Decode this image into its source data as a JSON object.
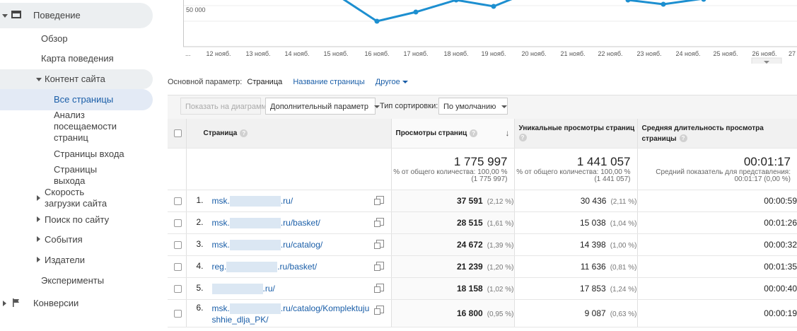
{
  "sidebar": {
    "behavior": "Поведение",
    "overview": "Обзор",
    "behavior_map": "Карта поведения",
    "site_content": "Контент сайта",
    "all_pages": "Все страницы",
    "analysis_l1": "Анализ",
    "analysis_l2": "посещаемости",
    "analysis_l3": "страниц",
    "landing_pages": "Страницы входа",
    "exit_l1": "Страницы",
    "exit_l2": "выхода",
    "speed_l1": "Скорость",
    "speed_l2": "загрузки сайта",
    "site_search": "Поиск по сайту",
    "events": "События",
    "publishers": "Издатели",
    "experiments": "Эксперименты",
    "conversions": "Конверсии"
  },
  "chart": {
    "y_label": "50 000",
    "x_labels": [
      "...",
      "12 нояб.",
      "13 нояб.",
      "14 нояб.",
      "15 нояб.",
      "16 нояб.",
      "17 нояб.",
      "18 нояб.",
      "19 нояб.",
      "20 нояб.",
      "21 нояб.",
      "22 нояб.",
      "23 нояб.",
      "24 нояб.",
      "25 нояб.",
      "26 нояб.",
      "27"
    ]
  },
  "primary_dimension": {
    "label": "Основной параметр:",
    "selected": "Страница",
    "page_title": "Название страницы",
    "other": "Другое"
  },
  "toolbar": {
    "plot_button": "Показать на диаграмме",
    "secondary_dim": "Дополнительный параметр",
    "sort_type_label": "Тип сортировки:",
    "sort_value": "По умолчанию"
  },
  "table": {
    "headers": {
      "page": "Страница",
      "pageviews": "Просмотры страниц",
      "unique": "Уникальные просмотры страниц",
      "avg_time": "Средняя длительность просмотра страницы"
    },
    "totals": {
      "pageviews": "1 775 997",
      "pageviews_sub1": "% от общего количества: 100,00 %",
      "pageviews_sub2": "(1 775 997)",
      "unique": "1 441 057",
      "unique_sub1": "% от общего количества: 100,00 %",
      "unique_sub2": "(1 441 057)",
      "avg_time": "00:01:17",
      "avg_sub1": "Средний показатель для представления:",
      "avg_sub2": "00:01:17 (0,00 %)"
    },
    "rows": [
      {
        "n": "1.",
        "prefix": "msk.",
        "suffix": ".ru/",
        "pv": "37 591",
        "pv_pct": "(2,12 %)",
        "u": "30 436",
        "u_pct": "(2,11 %)",
        "t": "00:00:59"
      },
      {
        "n": "2.",
        "prefix": "msk.",
        "suffix": ".ru/basket/",
        "pv": "28 515",
        "pv_pct": "(1,61 %)",
        "u": "15 038",
        "u_pct": "(1,04 %)",
        "t": "00:01:26"
      },
      {
        "n": "3.",
        "prefix": "msk.",
        "suffix": ".ru/catalog/",
        "pv": "24 672",
        "pv_pct": "(1,39 %)",
        "u": "14 398",
        "u_pct": "(1,00 %)",
        "t": "00:00:32"
      },
      {
        "n": "4.",
        "prefix": "reg.",
        "suffix": ".ru/basket/",
        "pv": "21 239",
        "pv_pct": "(1,20 %)",
        "u": "11 636",
        "u_pct": "(0,81 %)",
        "t": "00:01:35"
      },
      {
        "n": "5.",
        "prefix": "",
        "suffix": ".ru/",
        "pv": "18 158",
        "pv_pct": "(1,02 %)",
        "u": "17 853",
        "u_pct": "(1,24 %)",
        "t": "00:00:40"
      },
      {
        "n": "6.",
        "prefix": "msk.",
        "suffix": ".ru/catalog/Komplektuju",
        "suffix2": "shhie_dlja_PK/",
        "pv": "16 800",
        "pv_pct": "(0,95 %)",
        "u": "9 087",
        "u_pct": "(0,63 %)",
        "t": "00:00:19"
      }
    ]
  }
}
